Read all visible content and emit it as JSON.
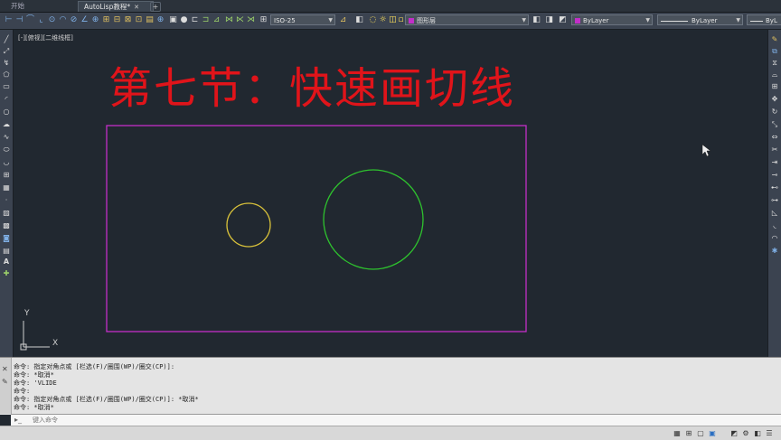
{
  "tabs": [
    {
      "label": "开始",
      "active": false
    },
    {
      "label": "AutoLisp教程*",
      "active": true
    }
  ],
  "toolbar": {
    "dimstyle": "ISO-25",
    "layer": "图形层",
    "color": "ByLayer",
    "linetype": "ByLayer",
    "lineweight": "ByL"
  },
  "viewport": {
    "label": "[-][俯视][二维线框]",
    "title": "第七节：快速画切线",
    "ucs_x": "X",
    "ucs_y": "Y"
  },
  "colors": {
    "title": "#e0141a",
    "rectangle": "#c22fc8",
    "small_circle": "#d9c23a",
    "large_circle": "#2ec22e",
    "background": "#212830"
  },
  "command_history": [
    "命令: 指定对角点或 [栏选(F)/圈围(WP)/圈交(CP)]:",
    "命令: *取消*",
    "命令: 'VLIDE",
    "命令:",
    "命令: 指定对角点或 [栏选(F)/圈围(WP)/圈交(CP)]: *取消*",
    "命令: *取消*"
  ],
  "command_input": {
    "placeholder": "键入命令"
  }
}
